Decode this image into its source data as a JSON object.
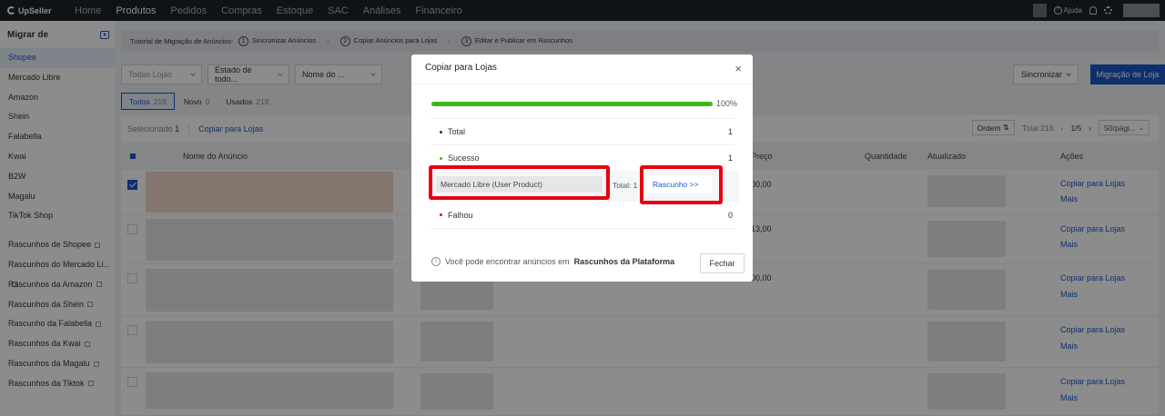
{
  "brand": "UpSeller",
  "nav": [
    "Home",
    "Produtos",
    "Pedidos",
    "Compras",
    "Estoque",
    "SAC",
    "Análises",
    "Financeiro"
  ],
  "nav_active": "Produtos",
  "help_label": "Ajuda",
  "sidebar": {
    "title": "Migrar de",
    "platforms": [
      "Shopee",
      "Mercado Libre",
      "Amazon",
      "Shein",
      "Falabella",
      "Kwai",
      "B2W",
      "Magalu",
      "TikTok Shop"
    ],
    "drafts": [
      "Rascunhos de Shopee",
      "Rascunhos do Mercado Li...",
      "Rascunhos da Amazon",
      "Rascunhos da Shein",
      "Rascunho da Falabella",
      "Rascunhos da Kwai",
      "Rascunhos da Magalu",
      "Rascunhos da Tiktok"
    ]
  },
  "tutorial": {
    "label": "Tutorial de Migração de Anúncios:",
    "steps": [
      {
        "num": "1",
        "label": "Sincronizar Anúncios"
      },
      {
        "num": "2",
        "label": "Copiar Anúncios para Lojas"
      },
      {
        "num": "3",
        "label": "Editar e Publicar em Rascunhos"
      }
    ]
  },
  "filters": {
    "stores_placeholder": "Todas Lojas",
    "state_placeholder": "Estado de todo...",
    "name_placeholder": "Nome do ..."
  },
  "buttons": {
    "sync": "Sincronizar",
    "migrate": "Migração de Loja"
  },
  "tabs": [
    {
      "label": "Todos",
      "count": "218"
    },
    {
      "label": "Novo",
      "count": "0"
    },
    {
      "label": "Usados",
      "count": "218"
    }
  ],
  "toolbar": {
    "selected_label": "Selecionado",
    "selected_count": "1",
    "copy_label": "Copiar para Lojas"
  },
  "pager": {
    "order": "Ordem",
    "total": "Total 218",
    "page": "1/5",
    "size": "50/pági..."
  },
  "table": {
    "headers": {
      "name": "Nome do Anúncio",
      "price": "Preço",
      "qty": "Quantidade",
      "updated": "Atualizado",
      "actions": "Ações"
    },
    "action_copy": "Copiar para Lojas",
    "action_more": "Mais",
    "prices": [
      "00,00",
      "13,00",
      "00,00",
      "",
      ""
    ]
  },
  "modal": {
    "title": "Copiar para Lojas",
    "progress": 100,
    "progress_label": "100%",
    "total_label": "Total",
    "total_value": "1",
    "success_label": "Sucesso",
    "success_value": "1",
    "store_name": "Mercado Libre (User Product)",
    "store_total": "Total: 1",
    "draft_link": "Rascunho >>",
    "fail_label": "Falhou",
    "fail_value": "0",
    "note_prefix": "Você pode encontrar anúncios em",
    "note_bold": "Rascunhos da Plataforma",
    "close_button": "Fechar"
  },
  "colors": {
    "accent": "#1a56c9",
    "success": "#3fb618",
    "fail": "#e60012",
    "highlight": "#e60012"
  }
}
